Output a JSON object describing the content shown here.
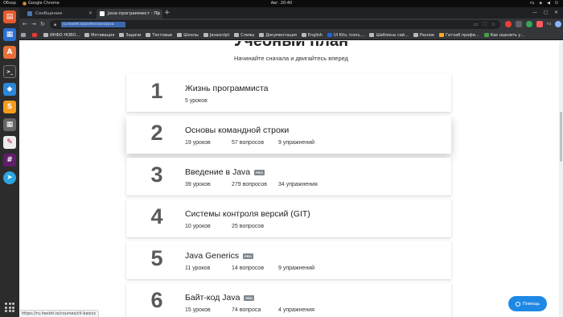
{
  "system": {
    "overview": "Обзор",
    "app_name": "Google Chrome",
    "clock": "Авг. 20:40",
    "lang": "ru"
  },
  "tabs": [
    {
      "title": "Сообщения",
      "active": false,
      "favicon_color": "#4a76a8"
    },
    {
      "title": "Java-программист - Пр",
      "active": true,
      "favicon_color": "#ffffff"
    }
  ],
  "omnibox": {
    "url": "ru.hexlet.io/professions/java"
  },
  "bookmarks": [
    {
      "label": "",
      "icon": "apps-icon",
      "color": "gray"
    },
    {
      "label": "",
      "icon": "red-icon",
      "color": "red"
    },
    {
      "label": "ИНФО НОВО...",
      "icon": "folder-icon",
      "color": "folder"
    },
    {
      "label": "Мотивация",
      "icon": "folder-icon",
      "color": "folder"
    },
    {
      "label": "Задачи",
      "icon": "folder-icon",
      "color": "folder"
    },
    {
      "label": "Тестовые",
      "icon": "folder-icon",
      "color": "folder"
    },
    {
      "label": "Школы",
      "icon": "folder-icon",
      "color": "folder"
    },
    {
      "label": "Javascript",
      "icon": "folder-icon",
      "color": "folder"
    },
    {
      "label": "Слияы",
      "icon": "folder-icon",
      "color": "folder"
    },
    {
      "label": "Документация",
      "icon": "folder-icon",
      "color": "folder"
    },
    {
      "label": "English",
      "icon": "folder-icon",
      "color": "folder"
    },
    {
      "label": "UI Kits, icons,...",
      "icon": "blue-icon",
      "color": "blue"
    },
    {
      "label": "Шаблоны сай...",
      "icon": "folder-icon",
      "color": "folder"
    },
    {
      "label": "Разное",
      "icon": "folder-icon",
      "color": "folder"
    },
    {
      "label": "Гитхаб профи...",
      "icon": "yellow-icon",
      "color": "yellow"
    },
    {
      "label": "Как оценить у...",
      "icon": "green-icon",
      "color": "green"
    }
  ],
  "page": {
    "hero_cut": "Учебный план",
    "subtitle": "Начинайте сначала и двигайтесь вперед",
    "pro_label": "PRO",
    "courses": [
      {
        "number": "1",
        "title": "Жизнь программиста",
        "pro": false,
        "lessons": "5 уроков",
        "questions": "",
        "exercises": ""
      },
      {
        "number": "2",
        "title": "Основы командной строки",
        "pro": false,
        "lessons": "19 уроков",
        "questions": "57 вопросов",
        "exercises": "9 упражнений"
      },
      {
        "number": "3",
        "title": "Введение в Java",
        "pro": true,
        "lessons": "39 уроков",
        "questions": "279 вопросов",
        "exercises": "34 упражнения"
      },
      {
        "number": "4",
        "title": "Системы контроля версий (GIT)",
        "pro": false,
        "lessons": "10 уроков",
        "questions": "25 вопросов",
        "exercises": ""
      },
      {
        "number": "5",
        "title": "Java Generics",
        "pro": true,
        "lessons": "11 уроков",
        "questions": "14 вопросов",
        "exercises": "9 упражнений"
      },
      {
        "number": "6",
        "title": "Байт-код Java",
        "pro": true,
        "lessons": "15 уроков",
        "questions": "74 вопроса",
        "exercises": "4 упражнения"
      }
    ],
    "help_label": "Помощь",
    "status_url": "https://ru.hexlet.io/courses/cli-basics"
  }
}
